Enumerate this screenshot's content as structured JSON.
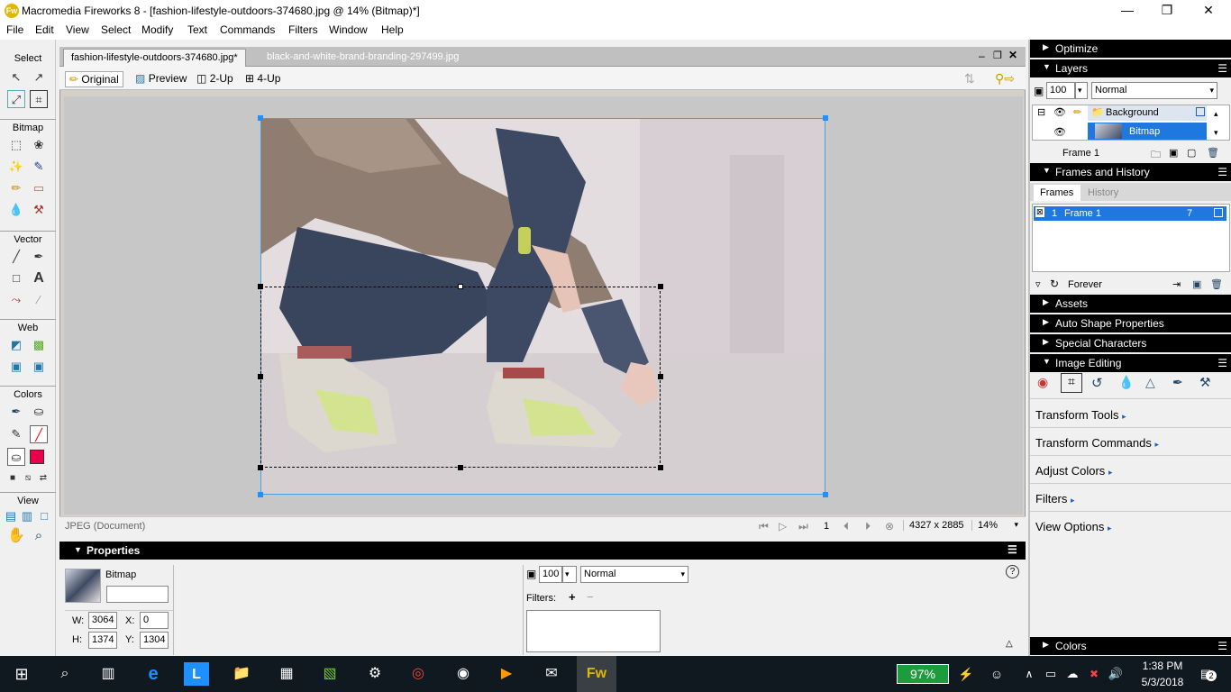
{
  "window": {
    "title": "Macromedia Fireworks 8 - [fashion-lifestyle-outdoors-374680.jpg @  14% (Bitmap)*]",
    "minimize": "—",
    "restore": "❐",
    "close": "✕"
  },
  "menu": [
    "File",
    "Edit",
    "View",
    "Select",
    "Modify",
    "Text",
    "Commands",
    "Filters",
    "Window",
    "Help"
  ],
  "tools": {
    "sections": [
      "Select",
      "Bitmap",
      "Vector",
      "Web",
      "Colors",
      "View"
    ]
  },
  "document": {
    "tabs": [
      "fashion-lifestyle-outdoors-374680.jpg*",
      "black-and-white-brand-branding-297499.jpg"
    ],
    "views": [
      "Original",
      "Preview",
      "2-Up",
      "4-Up"
    ],
    "status_left": "JPEG (Document)",
    "frame_num": "1",
    "dimensions": "4327 x 2885",
    "zoom": "14%"
  },
  "properties": {
    "header": "Properties",
    "type": "Bitmap",
    "name_value": "",
    "w_label": "W:",
    "w": "3064",
    "h_label": "H:",
    "h": "1374",
    "x_label": "X:",
    "x": "0",
    "y_label": "Y:",
    "y": "1304",
    "opacity": "100",
    "blend": "Normal",
    "filters_label": "Filters:",
    "help": "?"
  },
  "panels": {
    "optimize": "Optimize",
    "layers": "Layers",
    "layer_opacity": "100",
    "layer_blend": "Normal",
    "layer_background": "Background",
    "layer_bitmap": "Bitmap",
    "frame_label": "Frame 1",
    "frames_history": "Frames and History",
    "tab_frames": "Frames",
    "tab_history": "History",
    "frame_row_num": "1",
    "frame_row_name": "Frame 1",
    "frame_row_delay": "7",
    "loop": "Forever",
    "assets": "Assets",
    "auto_shape": "Auto Shape Properties",
    "special_chars": "Special Characters",
    "image_editing": "Image Editing",
    "ie_items": [
      "Transform Tools",
      "Transform Commands",
      "Adjust Colors",
      "Filters",
      "View Options"
    ],
    "colors": "Colors"
  },
  "taskbar": {
    "battery": "97%",
    "time": "1:38 PM",
    "date": "5/3/2018",
    "notifications": "2"
  },
  "colors": {
    "accent": "#1e90ff",
    "fill_swatch": "#e8004c",
    "battery_bg": "#1c9c3c"
  }
}
